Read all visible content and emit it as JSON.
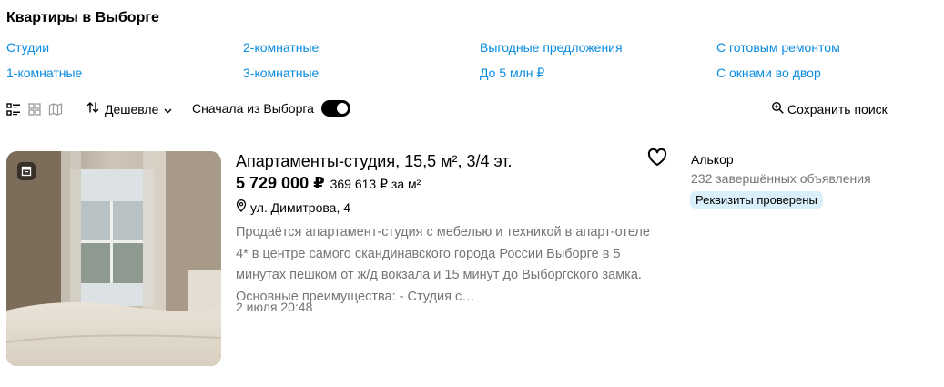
{
  "page": {
    "title": "Квартиры в Выборге"
  },
  "quick_links": {
    "col1": [
      "Студии",
      "1-комнатные"
    ],
    "col2": [
      "2-комнатные",
      "3-комнатные"
    ],
    "col3": [
      "Выгодные предложения",
      "До 5 млн ₽"
    ],
    "col4": [
      "С готовым ремонтом",
      "С окнами во двор"
    ]
  },
  "toolbar": {
    "views": [
      "list-view-icon",
      "grid-view-icon",
      "map-view-icon"
    ],
    "sort_label": "Дешевле",
    "toggle_label": "Сначала из Выборга",
    "toggle_on": true,
    "save_search_label": "Сохранить поиск"
  },
  "listing": {
    "title": "Апартаменты-студия, 15,5 м², 3/4 эт.",
    "price": "5 729 000 ₽",
    "price_per_sqm": "369 613 ₽ за м²",
    "address": "ул. Димитрова, 4",
    "description": "Продаётся апартамент-студия с мебелью и техникой в апарт-отеле 4* в центре самого скандинавского города России Выборге в 5 минутах пешком от ж/д вокзала и 15 минут до Выборгского замка. Основные преимущества: - Студия с…",
    "date": "2 июля 20:48"
  },
  "seller": {
    "name": "Алькор",
    "ads": "232 завершённых объявления",
    "badge": "Реквизиты проверены"
  },
  "colors": {
    "link": "#0a8be0",
    "muted": "#757575",
    "badge_bg": "#d9f0fb"
  }
}
